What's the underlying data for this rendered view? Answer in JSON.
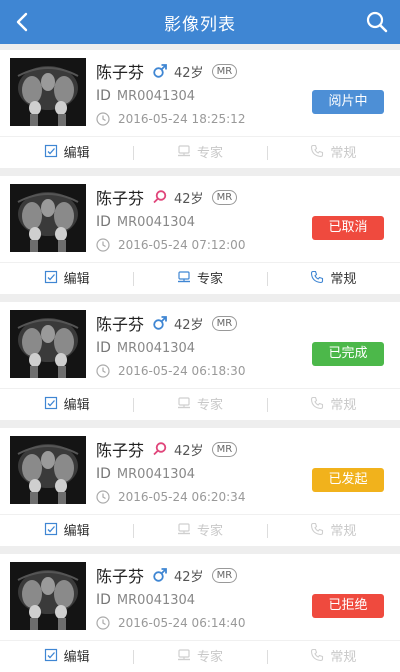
{
  "header": {
    "title": "影像列表"
  },
  "colors": {
    "header": "#3f86d3",
    "status_blue": "#4d8fd6",
    "status_red": "#ef4a3e",
    "status_green": "#4cb84a",
    "status_yellow": "#f1b21c",
    "male": "#3f86d3",
    "female": "#e0457a"
  },
  "records": [
    {
      "name": "陈子芬",
      "gender": "male-icon",
      "age": "42岁",
      "modality": "MR",
      "id_label": "ID",
      "id": "MR0041304",
      "time": "2016-05-24 18:25:12",
      "status": "阅片中",
      "status_color": "blue",
      "actions": [
        {
          "label": "编辑",
          "icon": "edit-icon",
          "enabled": true
        },
        {
          "label": "专家",
          "icon": "expert-icon",
          "enabled": false
        },
        {
          "label": "常规",
          "icon": "routine-icon",
          "enabled": false
        }
      ]
    },
    {
      "name": "陈子芬",
      "gender": "female-icon",
      "age": "42岁",
      "modality": "MR",
      "id_label": "ID",
      "id": "MR0041304",
      "time": "2016-05-24 07:12:00",
      "status": "已取消",
      "status_color": "red",
      "actions": [
        {
          "label": "编辑",
          "icon": "edit-icon",
          "enabled": true
        },
        {
          "label": "专家",
          "icon": "expert-icon",
          "enabled": true
        },
        {
          "label": "常规",
          "icon": "routine-icon",
          "enabled": true
        }
      ]
    },
    {
      "name": "陈子芬",
      "gender": "male-icon",
      "age": "42岁",
      "modality": "MR",
      "id_label": "ID",
      "id": "MR0041304",
      "time": "2016-05-24 06:18:30",
      "status": "已完成",
      "status_color": "green",
      "actions": [
        {
          "label": "编辑",
          "icon": "edit-icon",
          "enabled": true
        },
        {
          "label": "专家",
          "icon": "expert-icon",
          "enabled": false
        },
        {
          "label": "常规",
          "icon": "routine-icon",
          "enabled": false
        }
      ]
    },
    {
      "name": "陈子芬",
      "gender": "female-icon",
      "age": "42岁",
      "modality": "MR",
      "id_label": "ID",
      "id": "MR0041304",
      "time": "2016-05-24 06:20:34",
      "status": "已发起",
      "status_color": "yellow",
      "actions": [
        {
          "label": "编辑",
          "icon": "edit-icon",
          "enabled": true
        },
        {
          "label": "专家",
          "icon": "expert-icon",
          "enabled": false
        },
        {
          "label": "常规",
          "icon": "routine-icon",
          "enabled": false
        }
      ]
    },
    {
      "name": "陈子芬",
      "gender": "male-icon",
      "age": "42岁",
      "modality": "MR",
      "id_label": "ID",
      "id": "MR0041304",
      "time": "2016-05-24 06:14:40",
      "status": "已拒绝",
      "status_color": "red",
      "actions": [
        {
          "label": "编辑",
          "icon": "edit-icon",
          "enabled": true
        },
        {
          "label": "专家",
          "icon": "expert-icon",
          "enabled": false
        },
        {
          "label": "常规",
          "icon": "routine-icon",
          "enabled": false
        }
      ]
    }
  ]
}
